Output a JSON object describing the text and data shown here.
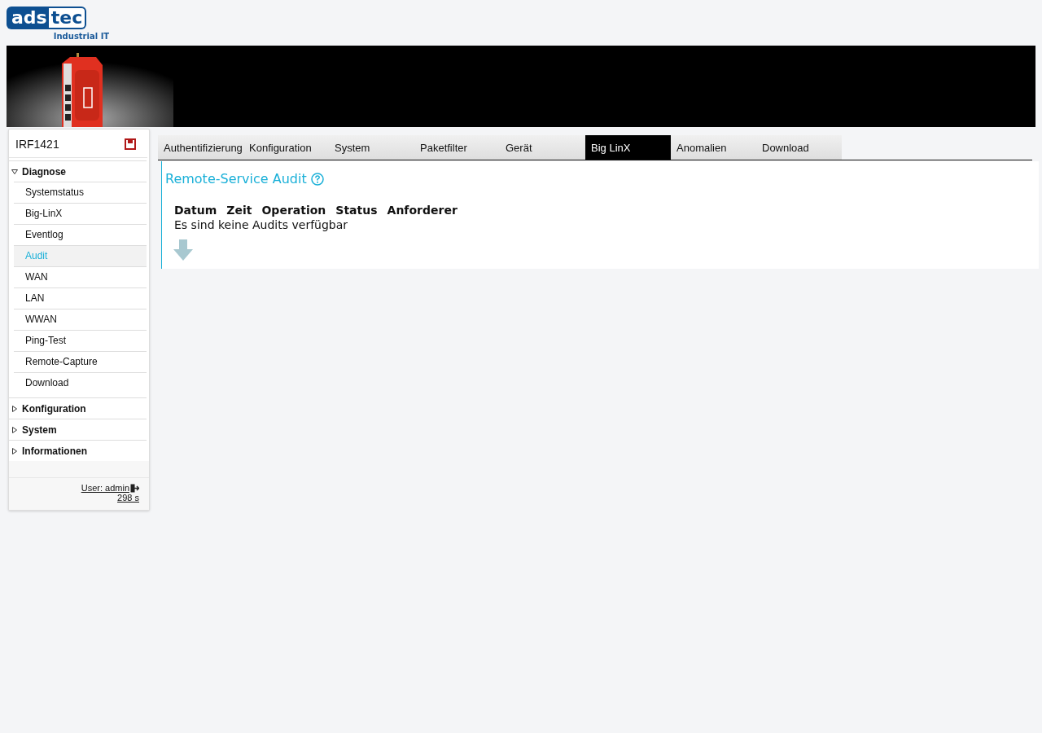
{
  "logo": {
    "part_1": "ads",
    "part_2": "tec",
    "tagline": "Industrial IT"
  },
  "sidebar": {
    "device": "IRF1421",
    "sections": [
      {
        "label": "Diagnose",
        "expanded": true,
        "items": [
          {
            "label": "Systemstatus",
            "selected": false
          },
          {
            "label": "Big-LinX",
            "selected": false
          },
          {
            "label": "Eventlog",
            "selected": false
          },
          {
            "label": "Audit",
            "selected": true
          },
          {
            "label": "WAN",
            "selected": false
          },
          {
            "label": "LAN",
            "selected": false
          },
          {
            "label": "WWAN",
            "selected": false
          },
          {
            "label": "Ping-Test",
            "selected": false
          },
          {
            "label": "Remote-Capture",
            "selected": false
          },
          {
            "label": "Download",
            "selected": false
          }
        ]
      },
      {
        "label": "Konfiguration",
        "expanded": false
      },
      {
        "label": "System",
        "expanded": false
      },
      {
        "label": "Informationen",
        "expanded": false
      }
    ],
    "user": "User: admin",
    "timer": "298 s"
  },
  "tabs": [
    {
      "label": "Authentifizierung",
      "selected": false
    },
    {
      "label": "Konfiguration",
      "selected": false
    },
    {
      "label": "System",
      "selected": false
    },
    {
      "label": "Paketfilter",
      "selected": false
    },
    {
      "label": "Gerät",
      "selected": false
    },
    {
      "label": "Big LinX",
      "selected": true
    },
    {
      "label": "Anomalien",
      "selected": false
    },
    {
      "label": "Download",
      "selected": false
    }
  ],
  "content": {
    "title": "Remote-Service Audit",
    "columns": [
      "Datum",
      "Zeit",
      "Operation",
      "Status",
      "Anforderer"
    ],
    "empty_message": "Es sind keine Audits verfügbar"
  }
}
